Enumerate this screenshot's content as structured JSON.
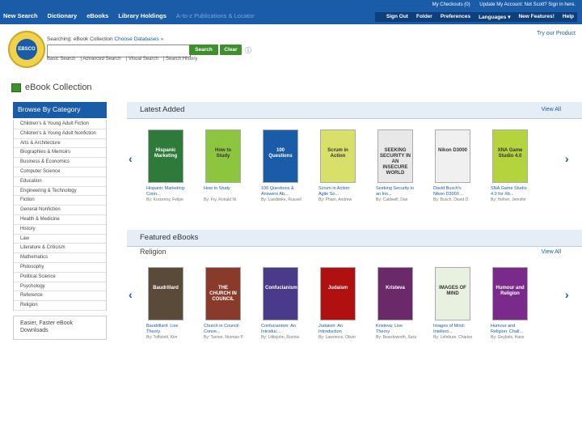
{
  "top_bar": {
    "right_links": [
      "My Checkouts (0)",
      "Update My Account: Not Scott? Sign in here."
    ],
    "nav": [
      "New Search",
      "Dictionary",
      "eBooks",
      "Library Holdings",
      "A-to-z Publications & Locator"
    ],
    "right_nav": [
      "Sign Out",
      "Folder",
      "Preferences",
      "Languages ▾",
      "New Features!",
      "Help"
    ]
  },
  "search": {
    "logo_text": "EBSCO",
    "searching_label": "Searching: eBook Collection",
    "choose_db": "Choose Databases »",
    "input_value": "",
    "search_button": "Search",
    "clear_button": "Clear",
    "help_icon": "help-icon",
    "sublinks": [
      "Basic Search",
      "Advanced Search",
      "Visual Search",
      "Search History"
    ],
    "try_product": "Try our Product"
  },
  "page": {
    "title": "eBook Collection"
  },
  "sidebar": {
    "heading": "Browse By Category",
    "categories": [
      "Children's & Young Adult Fiction",
      "Children's & Young Adult Nonfiction",
      "Arts & Architecture",
      "Biographies & Memoirs",
      "Business & Economics",
      "Computer Science",
      "Education",
      "Engineering & Technology",
      "Fiction",
      "General Nonfiction",
      "Health & Medicine",
      "History",
      "Law",
      "Literature & Criticism",
      "Mathematics",
      "Philosophy",
      "Political Science",
      "Psychology",
      "Reference",
      "Religion"
    ],
    "easy_access": "Easier, Faster eBook Downloads"
  },
  "latest": {
    "heading": "Latest Added",
    "view_all": "View All",
    "books": [
      {
        "title": "Hispanic Marketing: Conn...",
        "author": "By: Korzenny, Felipe",
        "cover": "Hispanic Marketing",
        "color": "#2d7a3a"
      },
      {
        "title": "How to Study",
        "author": "By: Fry, Ronald W.",
        "cover": "How to Study",
        "color": "#8cc63f"
      },
      {
        "title": "100 Questions & Answers Ab...",
        "author": "By: Lueddeke, Russell",
        "cover": "100 Questions",
        "color": "#1a5ca8"
      },
      {
        "title": "Scrum in Action: Agile So...",
        "author": "By: Pham, Andrew",
        "cover": "Scrum in Action",
        "color": "#d9e06a"
      },
      {
        "title": "Seeking Security in an Ins...",
        "author": "By: Caldwell, Dan",
        "cover": "SEEKING SECURITY IN AN INSECURE WORLD",
        "color": "#e8e8e8"
      },
      {
        "title": "David Busch's Nikon D3000 ...",
        "author": "By: Busch, David D.",
        "cover": "Nikon D3000",
        "color": "#f0f0f0"
      },
      {
        "title": "SNA Game Studio 4.0 for Xb...",
        "author": "By: Hefner, Jennifer",
        "cover": "XNA Game Studio 4.0",
        "color": "#b5d33d"
      }
    ]
  },
  "featured": {
    "heading": "Featured eBooks",
    "subheading": "Religion",
    "view_all": "View All",
    "books": [
      {
        "title": "Baudrillard: Live Theory",
        "author": "By: Toffoletti, Kim",
        "cover": "Baudrillard",
        "color": "#5a4a3a"
      },
      {
        "title": "Church in Council: Conve...",
        "author": "By: Tanner, Norman P.",
        "cover": "THE CHURCH IN COUNCIL",
        "color": "#8a3a2a"
      },
      {
        "title": "Confucianism: An Introduc...",
        "author": "By: Littlejohn, Ronnie",
        "cover": "Confucianism",
        "color": "#4a3a8a"
      },
      {
        "title": "Judaism: An Introduction",
        "author": "By: Lawrence, Oliver",
        "cover": "Judaism",
        "color": "#b01010"
      },
      {
        "title": "Kristeva: Live Theory",
        "author": "By: Beardsworth, Sara",
        "cover": "Kristeva",
        "color": "#6a2a6a"
      },
      {
        "title": "Images of Mind: Intellect...",
        "author": "By: Lefebure, Charles",
        "cover": "IMAGES OF MIND",
        "color": "#e8f0e0"
      },
      {
        "title": "Humour and Religion: Chall...",
        "author": "By: Geybels, Hans",
        "cover": "Humour and Religion",
        "color": "#7a2a8a"
      }
    ]
  }
}
